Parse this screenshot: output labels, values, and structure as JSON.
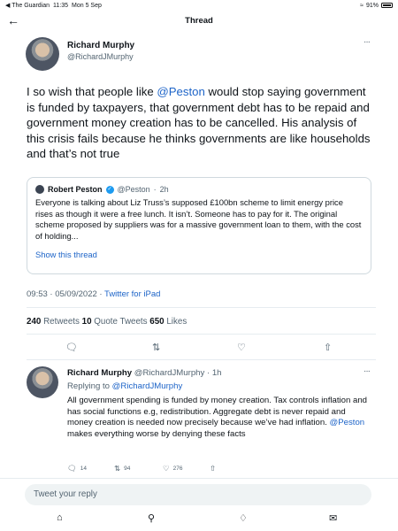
{
  "status_bar": {
    "app": "◀ The Guardian",
    "time": "11:35",
    "date": "Mon 5 Sep",
    "battery": "91%"
  },
  "header": {
    "title": "Thread"
  },
  "tweet": {
    "author_name": "Richard Murphy",
    "author_handle": "@RichardJMurphy",
    "more": "···",
    "text_before": "I so wish that people like ",
    "mention": "@Peston",
    "text_after": " would stop saying government is funded by taxpayers, that government debt has to be repaid and government money creation has to be cancelled. His analysis of this crisis fails because he thinks governments are like households and that’s not true",
    "quote": {
      "name": "Robert Peston",
      "handle": "@Peston",
      "sep": "·",
      "time": "2h",
      "text": "Everyone is talking about Liz Truss’s supposed £100bn scheme to limit energy price rises as though it were a free lunch. It isn’t. Someone has to pay for it. The original scheme proposed by suppliers was for a massive government loan to them, with the cost of holding...",
      "show_thread": "Show this thread"
    },
    "timestamp": "09:53 · 05/09/2022 · ",
    "source": "Twitter for iPad",
    "retweets": "240",
    "retweets_label": " Retweets  ",
    "quote_tweets": "10",
    "quote_tweets_label": " Quote Tweets  ",
    "likes": "650",
    "likes_label": " Likes",
    "actions": [
      "reply-icon",
      "retweet-icon",
      "like-icon",
      "share-icon"
    ]
  },
  "reply": {
    "author_name": "Richard Murphy",
    "author_handle": "@RichardJMurphy",
    "time": " · 1h",
    "more": "···",
    "replying_to_label": "Replying to ",
    "replying_to": "@RichardJMurphy",
    "text_before": "All government spending is funded by money creation. Tax controls inflation and has social functions e.g, redistribution. Aggregate debt is never repaid and money creation is needed now precisely because we’ve had inflation. ",
    "mention": "@Peston",
    "text_after": " makes everything worse by denying these facts",
    "replies": "14",
    "retweets": "94",
    "likes": "276"
  },
  "composer": {
    "placeholder": "Tweet your reply"
  },
  "tabs": [
    "home-icon",
    "search-icon",
    "notifications-icon",
    "messages-icon"
  ]
}
